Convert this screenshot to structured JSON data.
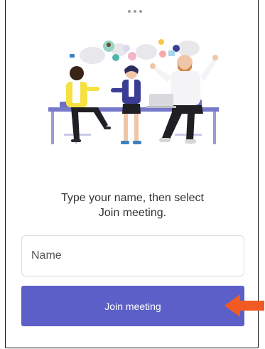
{
  "prompt": {
    "line1": "Type your name, then select",
    "line2": "Join meeting."
  },
  "name_input": {
    "value": "",
    "placeholder": "Name"
  },
  "join_button": {
    "label": "Join meeting"
  },
  "colors": {
    "accent": "#5b5fc7",
    "arrow": "#f15a22"
  },
  "icons": {
    "handle": "more-dots-icon",
    "arrow": "arrow-left-icon",
    "illustration": "meeting-illustration"
  }
}
